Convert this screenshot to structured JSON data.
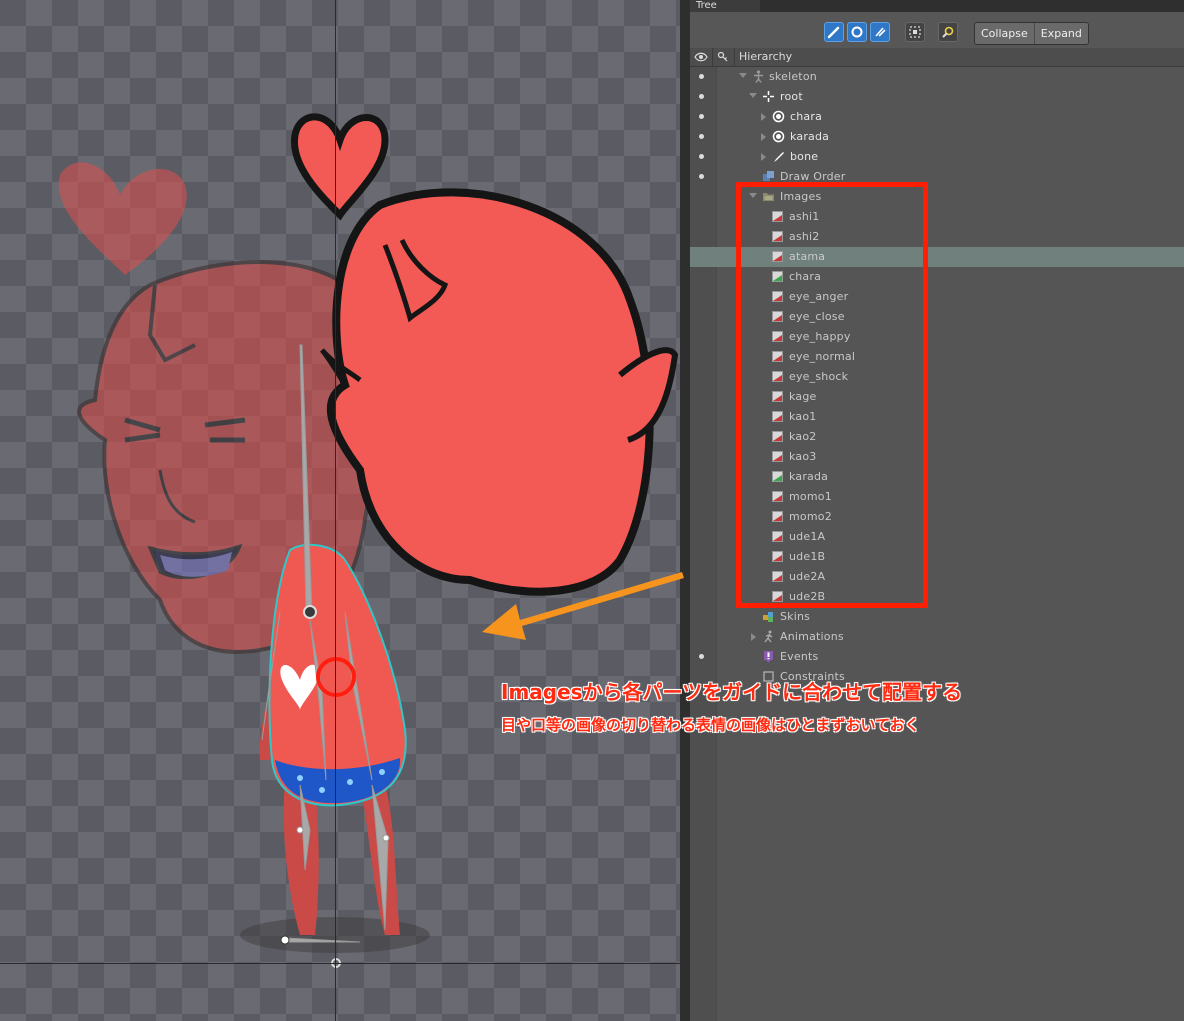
{
  "panel": {
    "tab_title": "Tree"
  },
  "toolbar": {
    "icons": [
      "bone-filter-icon",
      "slot-filter-icon",
      "attachment-filter-icon",
      "frame-icon",
      "search-icon"
    ],
    "collapse_label": "Collapse",
    "expand_label": "Expand"
  },
  "tree": {
    "header": {
      "title": "Hierarchy"
    },
    "nodes": [
      {
        "label": "skeleton",
        "icon": "skeleton-icon",
        "expanded": true
      },
      {
        "label": "root",
        "icon": "root-bone-icon",
        "expanded": true
      },
      {
        "label": "chara",
        "icon": "slot-icon",
        "expanded": false
      },
      {
        "label": "karada",
        "icon": "slot-icon",
        "expanded": false
      },
      {
        "label": "bone",
        "icon": "bone-icon",
        "expanded": false
      },
      {
        "label": "Draw Order",
        "icon": "draw-order-icon"
      },
      {
        "label": "Images",
        "icon": "folder-icon",
        "expanded": true
      },
      {
        "label": "Skins",
        "icon": "skins-icon"
      },
      {
        "label": "Animations",
        "icon": "animations-icon",
        "expanded": false
      },
      {
        "label": "Events",
        "icon": "events-icon"
      },
      {
        "label": "Constraints",
        "icon": "constraints-icon"
      }
    ],
    "images": [
      {
        "label": "ashi1",
        "color": "red"
      },
      {
        "label": "ashi2",
        "color": "red"
      },
      {
        "label": "atama",
        "color": "red",
        "selected": true
      },
      {
        "label": "chara",
        "color": "green"
      },
      {
        "label": "eye_anger",
        "color": "red"
      },
      {
        "label": "eye_close",
        "color": "red"
      },
      {
        "label": "eye_happy",
        "color": "red"
      },
      {
        "label": "eye_normal",
        "color": "red"
      },
      {
        "label": "eye_shock",
        "color": "red"
      },
      {
        "label": "kage",
        "color": "red"
      },
      {
        "label": "kao1",
        "color": "red"
      },
      {
        "label": "kao2",
        "color": "red"
      },
      {
        "label": "kao3",
        "color": "red"
      },
      {
        "label": "karada",
        "color": "green"
      },
      {
        "label": "momo1",
        "color": "red"
      },
      {
        "label": "momo2",
        "color": "red"
      },
      {
        "label": "ude1A",
        "color": "red"
      },
      {
        "label": "ude1B",
        "color": "red"
      },
      {
        "label": "ude2A",
        "color": "red"
      },
      {
        "label": "ude2B",
        "color": "red"
      }
    ]
  },
  "annotations": {
    "line1": "Imagesから各パーツをガイドに合わせて配置する",
    "line2": "目や口等の画像の切り替わる表情の画像はひとまずおいておく"
  },
  "colors": {
    "highlight": "#ff1e00",
    "arrow": "#f7941d",
    "character": "#f35a55",
    "selection": "#6f807d"
  }
}
